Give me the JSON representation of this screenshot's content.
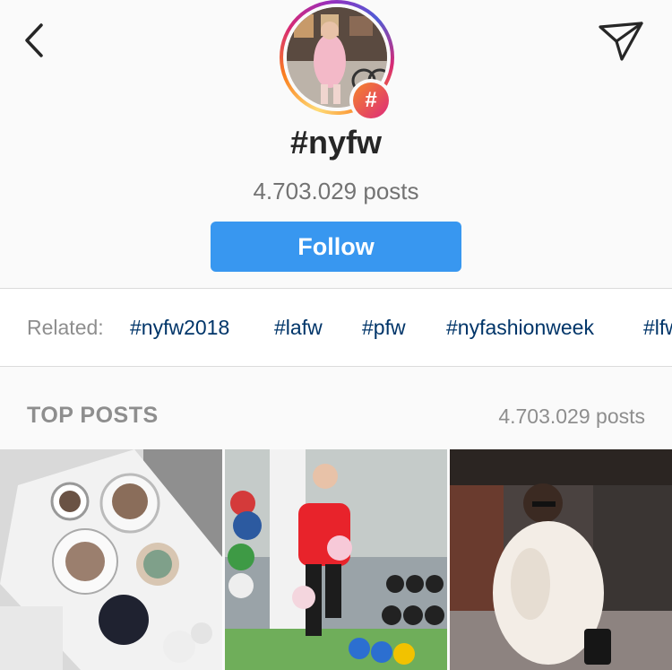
{
  "header": {
    "title": "#nyfw",
    "post_count": "4.703.029 posts",
    "follow_label": "Follow",
    "badge_symbol": "#",
    "icons": {
      "back": "chevron-left-icon",
      "share": "paper-plane-icon"
    }
  },
  "related": {
    "label": "Related:",
    "tags": [
      "#nyfw2018",
      "#lafw",
      "#pfw",
      "#nyfashionweek",
      "#lfw"
    ]
  },
  "top_posts": {
    "title": "TOP POSTS",
    "count": "4.703.029 posts",
    "items": [
      "coffee-table-post",
      "gym-kettlebell-post",
      "fur-coat-street-post"
    ]
  },
  "colors": {
    "follow_button": "#3897f0",
    "hashtag_link": "#003569",
    "muted_text": "#8e8e8e",
    "badge_gradient_start": "#f58529",
    "badge_gradient_end": "#dd2a7b"
  }
}
